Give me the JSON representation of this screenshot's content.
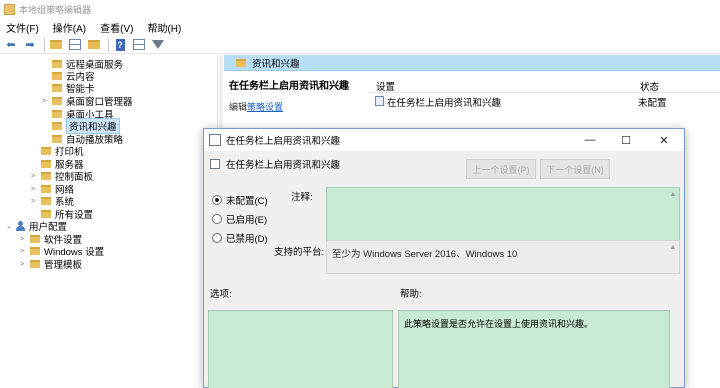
{
  "window": {
    "title": "本地组策略编辑器"
  },
  "menu": [
    "文件(F)",
    "操作(A)",
    "查看(V)",
    "帮助(H)"
  ],
  "tree": {
    "items": [
      {
        "label": "远程桌面服务",
        "indent": 1,
        "expander": ""
      },
      {
        "label": "云内容",
        "indent": 1,
        "expander": ""
      },
      {
        "label": "智能卡",
        "indent": 1,
        "expander": ""
      },
      {
        "label": "桌面窗口管理器",
        "indent": 1,
        "expander": ">"
      },
      {
        "label": "桌面小工具",
        "indent": 1,
        "expander": ""
      },
      {
        "label": "资讯和兴趣",
        "indent": 1,
        "expander": "",
        "selected": true
      },
      {
        "label": "自动播放策略",
        "indent": 1,
        "expander": ""
      },
      {
        "label": "打印机",
        "indent": 0,
        "expander": ""
      },
      {
        "label": "服务器",
        "indent": 0,
        "expander": ""
      },
      {
        "label": "控制面板",
        "indent": 0,
        "expander": ">"
      },
      {
        "label": "网络",
        "indent": 0,
        "expander": ">"
      },
      {
        "label": "系统",
        "indent": 0,
        "expander": ">"
      },
      {
        "label": "所有设置",
        "indent": 0,
        "expander": ""
      }
    ],
    "user_config": "用户配置",
    "user_children": [
      "软件设置",
      "Windows 设置",
      "管理模板"
    ]
  },
  "panel": {
    "header": "资讯和兴趣",
    "policy_title": "在任务栏上启用资讯和兴趣",
    "edit_prefix": "编辑",
    "edit_link": "策略设置"
  },
  "list": {
    "columns": [
      "设置",
      "状态"
    ],
    "rows": [
      {
        "name": "在任务栏上启用资讯和兴趣",
        "state": "未配置"
      }
    ]
  },
  "dialog": {
    "title": "在任务栏上启用资讯和兴趣",
    "subtitle": "在任务栏上启用资讯和兴趣",
    "prev_label": "上一个设置(P)",
    "next_label": "下一个设置(N)",
    "radios": [
      "未配置(C)",
      "已启用(E)",
      "已禁用(D)"
    ],
    "selected_radio": 0,
    "comment_label": "注释:",
    "supported_label": "支持的平台:",
    "supported_value": "至少为 Windows Server 2016、Windows 10",
    "options_label": "选项:",
    "help_label": "帮助:",
    "help_text": "此策略设置是否允许在设置上使用资讯和兴趣。"
  }
}
